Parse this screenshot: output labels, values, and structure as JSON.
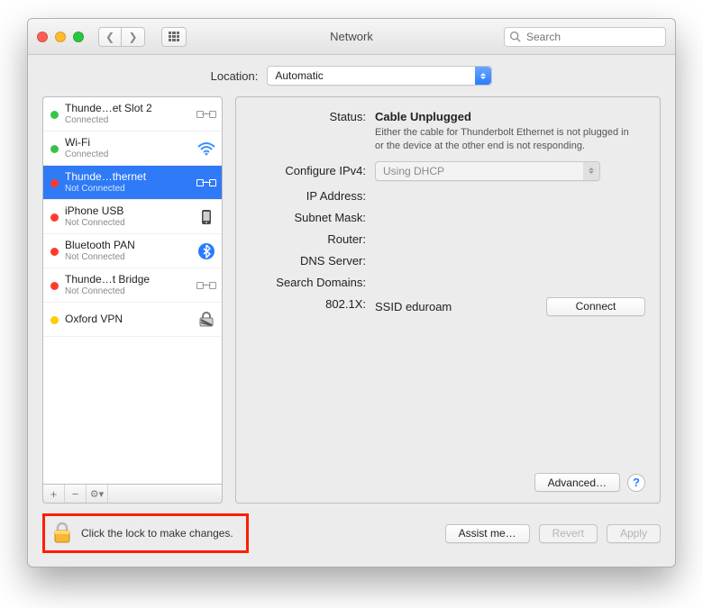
{
  "window": {
    "title": "Network"
  },
  "toolbar": {
    "search_placeholder": "Search"
  },
  "location": {
    "label": "Location:",
    "value": "Automatic"
  },
  "sidebar": {
    "items": [
      {
        "name": "Thunde…et Slot 2",
        "sub": "Connected",
        "status": "green",
        "icon": "connection"
      },
      {
        "name": "Wi-Fi",
        "sub": "Connected",
        "status": "green",
        "icon": "wifi"
      },
      {
        "name": "Thunde…thernet",
        "sub": "Not Connected",
        "status": "red",
        "icon": "connection",
        "selected": true
      },
      {
        "name": "iPhone USB",
        "sub": "Not Connected",
        "status": "red",
        "icon": "phone"
      },
      {
        "name": "Bluetooth PAN",
        "sub": "Not Connected",
        "status": "red",
        "icon": "bluetooth"
      },
      {
        "name": "Thunde…t Bridge",
        "sub": "Not Connected",
        "status": "red",
        "icon": "connection"
      },
      {
        "name": "Oxford VPN",
        "sub": "",
        "status": "yellow",
        "icon": "lock"
      }
    ]
  },
  "details": {
    "status_label": "Status:",
    "status_value": "Cable Unplugged",
    "status_desc": "Either the cable for Thunderbolt Ethernet is not plugged in or the device at the other end is not responding.",
    "configure_label": "Configure IPv4:",
    "configure_value": "Using DHCP",
    "ip_label": "IP Address:",
    "subnet_label": "Subnet Mask:",
    "router_label": "Router:",
    "dns_label": "DNS Server:",
    "search_label": "Search Domains:",
    "x_label": "802.1X:",
    "x_value": "SSID eduroam",
    "connect_btn": "Connect",
    "advanced_btn": "Advanced…"
  },
  "footer": {
    "lock_text": "Click the lock to make changes.",
    "assist_btn": "Assist me…",
    "revert_btn": "Revert",
    "apply_btn": "Apply"
  }
}
